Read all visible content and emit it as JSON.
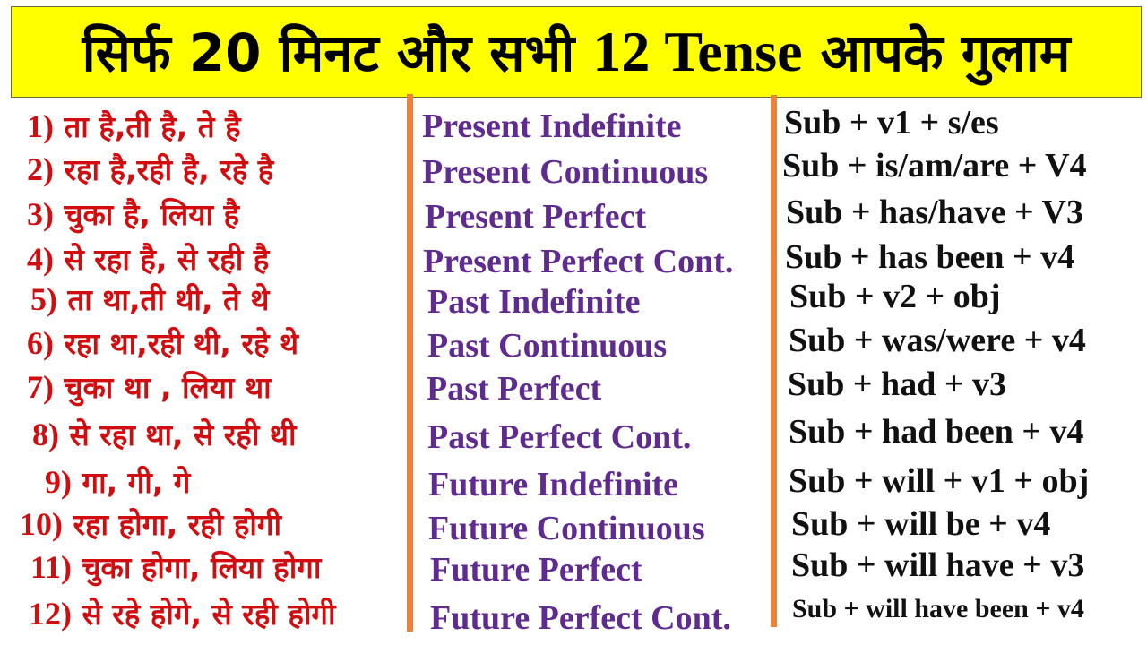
{
  "banner": {
    "title_part1": "सिर्फ 20 मिनट और सभी ",
    "title_part2": "12 Tense",
    "title_part3": " आपके गुलाम",
    "background_color": "#ffff00"
  },
  "colors": {
    "hindi_text": "#d10d10",
    "tense_text": "#5f2b91",
    "formula_text": "#111111",
    "divider": "#e8843a"
  },
  "rows": [
    {
      "num": "1)",
      "hindi": "ता है,ती है, ते है",
      "tense": "Present Indefinite",
      "formula": "Sub + v1 + s/es"
    },
    {
      "num": "2)",
      "hindi": "रहा है,रही है, रहे है",
      "tense": "Present Continuous",
      "formula": "Sub + is/am/are + V4"
    },
    {
      "num": "3)",
      "hindi": "चुका है, लिया है",
      "tense": "Present Perfect",
      "formula": "Sub + has/have + V3"
    },
    {
      "num": "4)",
      "hindi": "से रहा है, से रही है",
      "tense": "Present Perfect Cont.",
      "formula": "Sub + has been + v4"
    },
    {
      "num": "5)",
      "hindi": "ता था,ती थी, ते थे",
      "tense": "Past Indefinite",
      "formula": "Sub + v2 + obj"
    },
    {
      "num": "6)",
      "hindi": "रहा था,रही थी, रहे थे",
      "tense": "Past Continuous",
      "formula": "Sub + was/were + v4"
    },
    {
      "num": "7)",
      "hindi": "चुका था , लिया था",
      "tense": "Past Perfect",
      "formula": "Sub + had + v3"
    },
    {
      "num": "8)",
      "hindi": "से रहा था, से रही थी",
      "tense": "Past Perfect Cont.",
      "formula": "Sub + had been + v4"
    },
    {
      "num": "9)",
      "hindi": "गा, गी, गे",
      "tense": "Future Indefinite",
      "formula": "Sub + will + v1 + obj"
    },
    {
      "num": "10)",
      "hindi": "रहा होगा, रही होगी",
      "tense": "Future Continuous",
      "formula": "Sub + will be + v4"
    },
    {
      "num": "11)",
      "hindi": "चुका होगा, लिया होगा",
      "tense": "Future Perfect",
      "formula": "Sub + will have + v3"
    },
    {
      "num": "12)",
      "hindi": "से रहे होगे, से रही होगी",
      "tense": "Future Perfect Cont.",
      "formula": "Sub + will have been + v4"
    }
  ]
}
